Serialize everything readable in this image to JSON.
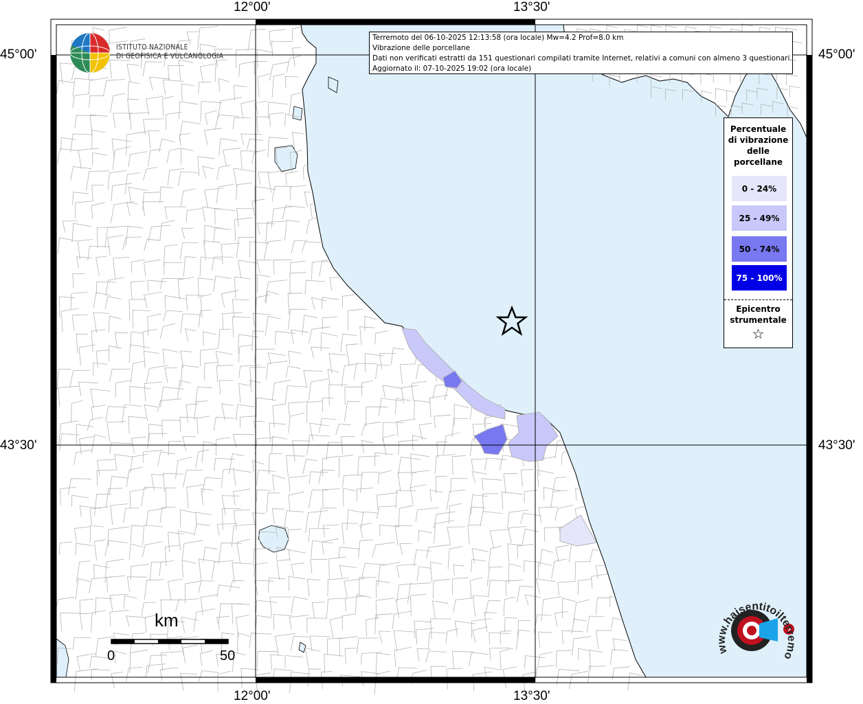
{
  "header": {
    "line1": "Terremoto del 06-10-2025 12:13:58 (ora locale) Mw=4.2 Prof=8.0 km",
    "line2": "Vibrazione delle porcellane",
    "line3": "Dati non verificati estratti da 151 questionari compilati tramite Internet, relativi a comuni con almeno 3 questionari.",
    "line4": "Aggiornato il: 07-10-2025 19:02 (ora locale)"
  },
  "axes": {
    "lon_top_left": "12°00'",
    "lon_top_right": "13°30'",
    "lon_bottom_left": "12°00'",
    "lon_bottom_right": "13°30'",
    "lat_upper_left": "45°00'",
    "lat_upper_right": "45°00'",
    "lat_lower_left": "43°30'",
    "lat_lower_right": "43°30'"
  },
  "logo": {
    "org_line1": "ISTITUTO NAZIONALE",
    "org_line2": "DI GEOFISICA E VULCANOLOGIA"
  },
  "legend": {
    "title": [
      "Percentuale",
      "di vibrazione",
      "delle",
      "porcellane"
    ],
    "items": [
      {
        "label": "0 - 24%",
        "color": "#e6e6fa"
      },
      {
        "label": "25 - 49%",
        "color": "#c8c8fa"
      },
      {
        "label": "50 - 74%",
        "color": "#7878f0"
      },
      {
        "label": "75 - 100%",
        "color": "#0000e6"
      }
    ],
    "epicenter_line1": "Epicentro",
    "epicenter_line2": "strumentale",
    "epicenter_symbol": "☆"
  },
  "scale_bar": {
    "unit": "km",
    "min": "0",
    "max": "50"
  },
  "brand": {
    "text": "www.haisentitoilterremoto.it"
  },
  "colors": {
    "sea": "#dff0fb",
    "land": "#ffffff",
    "borders": "#b4b4b4",
    "grid": "#000000"
  }
}
